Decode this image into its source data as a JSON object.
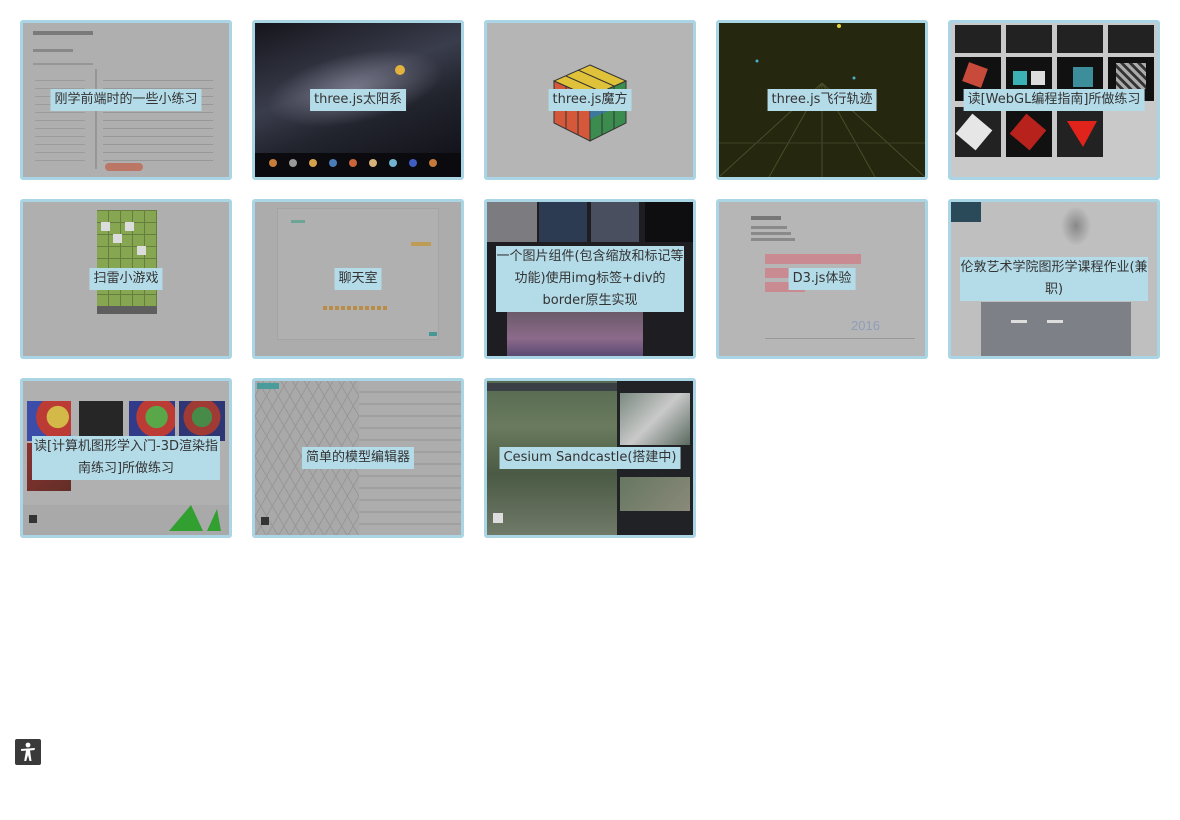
{
  "projects": [
    {
      "label": "刚学前端时的一些小练习"
    },
    {
      "label": "three.js太阳系"
    },
    {
      "label": "three.js魔方"
    },
    {
      "label": "three.js飞行轨迹"
    },
    {
      "label": "读[WebGL编程指南]所做练习"
    },
    {
      "label": "扫雷小游戏"
    },
    {
      "label": "聊天室"
    },
    {
      "label": "一个图片组件(包含缩放和标记等功能)使用img标签+div的border原生实现"
    },
    {
      "label": "D3.js体验",
      "thumb_year": "2016"
    },
    {
      "label": "伦敦艺术学院图形学课程作业(兼职)"
    },
    {
      "label": "读[计算机图形学入门-3D渲染指南练习]所做练习"
    },
    {
      "label": "简单的模型编辑器"
    },
    {
      "label": "Cesium Sandcastle(搭建中)"
    }
  ],
  "floating_button": {
    "icon": "accessibility-icon"
  },
  "colors": {
    "card_border": "#a9d5e4",
    "label_bg": "#b4dbe8"
  }
}
